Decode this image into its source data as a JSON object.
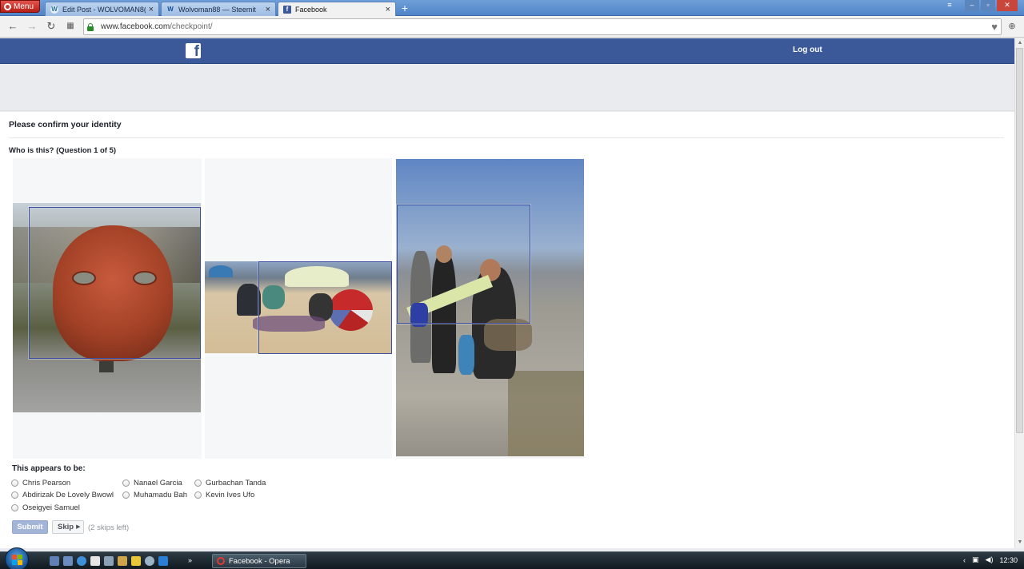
{
  "browser": {
    "menu_label": "Menu",
    "tabs": [
      {
        "title": "Edit Post - WOLVOMAN8(",
        "icon": "wordpress-icon"
      },
      {
        "title": "Wolvoman88 — Steemit",
        "icon": "steemit-icon"
      },
      {
        "title": "Facebook",
        "icon": "facebook-icon"
      }
    ],
    "new_tab": "+",
    "url_domain": "www.facebook.com",
    "url_path": "/checkpoint/"
  },
  "header": {
    "logout_label": "Log out"
  },
  "checkpoint": {
    "title": "Please confirm your identity",
    "question": "Who is this? (Question 1 of 5)",
    "appears_label": "This appears to be:",
    "options": [
      "Chris Pearson",
      "Nanael Garcia",
      "Gurbachan Tanda",
      "Abdirizak De Lovely Bwowl",
      "Muhamadu Bah",
      "Kevin Ives Ufo",
      "Oseigyei Samuel"
    ],
    "submit_label": "Submit",
    "skip_label": "Skip",
    "skips_left": "(2 skips left)"
  },
  "taskbar": {
    "task_label": "Facebook - Opera",
    "clock": "12:30"
  },
  "colors": {
    "facebook_blue": "#3b5998",
    "submit_disabled": "#a3b5d7"
  }
}
